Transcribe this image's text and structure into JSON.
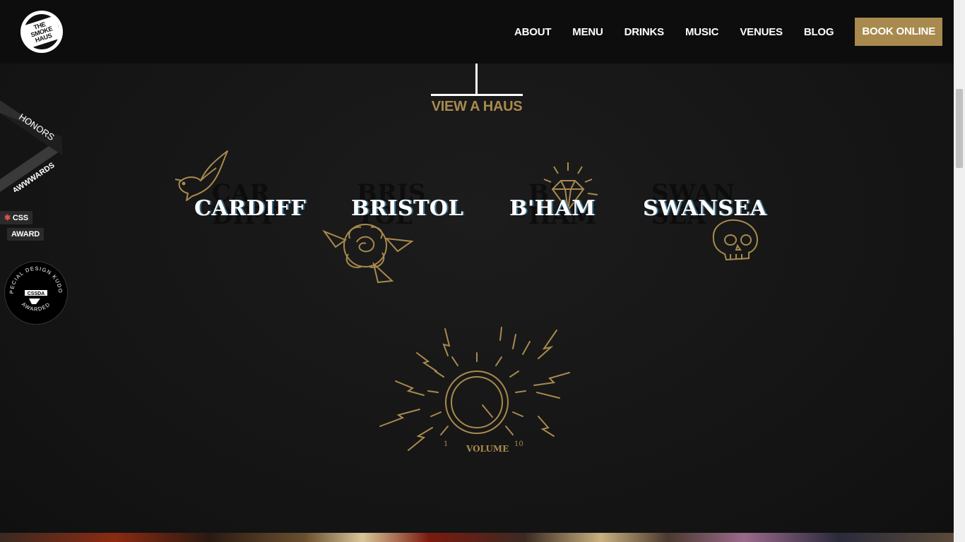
{
  "header": {
    "logo_text": "THE SMOKE HAUS",
    "nav": [
      "ABOUT",
      "MENU",
      "DRINKS",
      "MUSIC",
      "VENUES",
      "BLOG"
    ],
    "book_label": "BOOK ONLINE"
  },
  "venues": {
    "title": "VIEW A HAUS",
    "cities": [
      "CARDIFF",
      "BRISTOL",
      "B'HAM",
      "SWANSEA"
    ]
  },
  "awards": {
    "awwwards_honors": "HONORS",
    "awwwards_name": "AWWWARDS",
    "css_label": "CSS",
    "css_award": "AWARD",
    "cssda_text": "SPECIAL DESIGN KUDOS",
    "cssda_name": "CSSDA",
    "cssda_awarded": "AWARDED"
  },
  "volume_knob": {
    "min_label": "1",
    "label": "VOLUME",
    "max_label": "10"
  },
  "colors": {
    "accent": "#a88a4e",
    "background": "#151515"
  }
}
